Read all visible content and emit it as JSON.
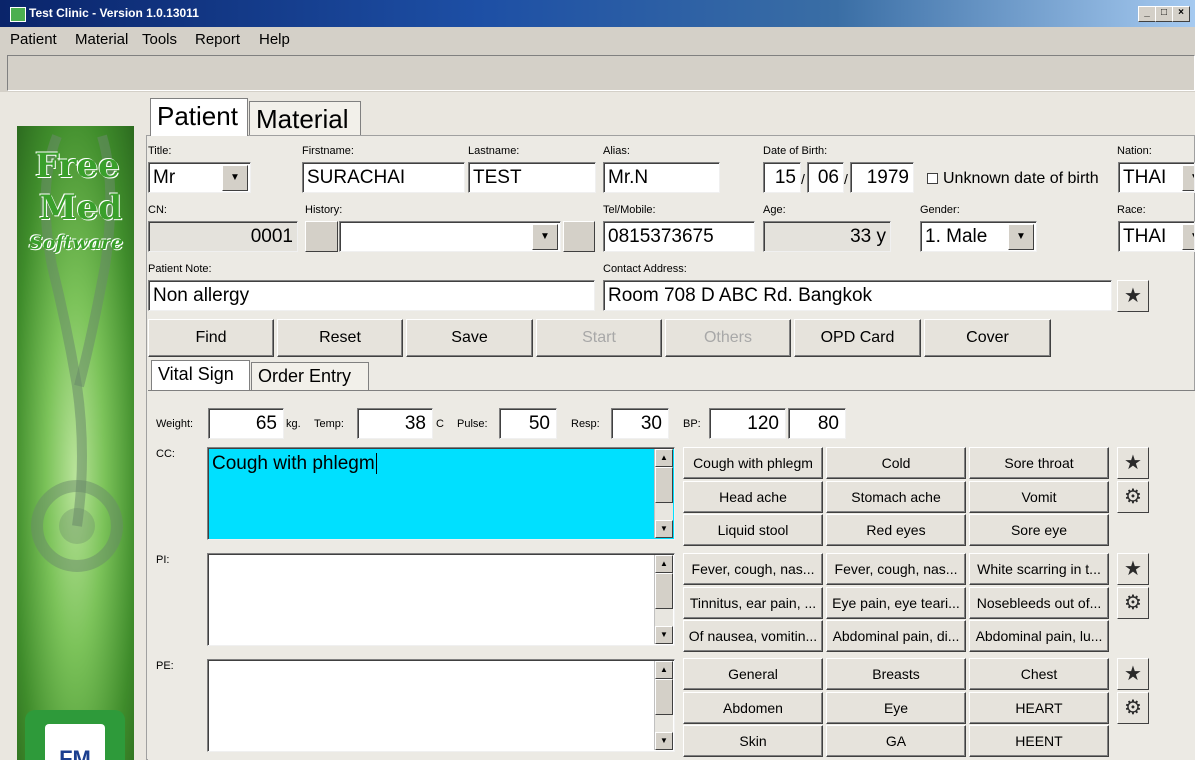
{
  "window": {
    "title": "Test Clinic - Version 1.0.13011",
    "min": "_",
    "max": "□",
    "close": "×"
  },
  "menu": [
    "Patient",
    "Material",
    "Tools",
    "Report",
    "Help"
  ],
  "sidebar": {
    "logo_line1": "Free",
    "logo_line2": "Med",
    "logo_line3": "Software",
    "badge": "FM"
  },
  "main_tabs": [
    "Patient",
    "Material"
  ],
  "form": {
    "title_label": "Title:",
    "title_value": "Mr",
    "firstname_label": "Firstname:",
    "firstname_value": "SURACHAI",
    "lastname_label": "Lastname:",
    "lastname_value": "TEST",
    "alias_label": "Alias:",
    "alias_value": "Mr.N",
    "dob_label": "Date of Birth:",
    "dob_day": "15",
    "dob_month": "06",
    "dob_year": "1979",
    "dob_sep": "/",
    "unknown_dob_label": "Unknown date of birth",
    "nation_label": "Nation:",
    "nation_value": "THAI",
    "cn_label": "CN:",
    "cn_value": "0001",
    "history_label": "History:",
    "history_value": "",
    "tel_label": "Tel/Mobile:",
    "tel_value": "0815373675",
    "age_label": "Age:",
    "age_value": "33 y",
    "gender_label": "Gender:",
    "gender_value": "1. Male",
    "race_label": "Race:",
    "race_value": "THAI",
    "note_label": "Patient Note:",
    "note_value": "Non allergy",
    "address_label": "Contact Address:",
    "address_value": "Room 708 D ABC Rd. Bangkok"
  },
  "actions": {
    "find": "Find",
    "reset": "Reset",
    "save": "Save",
    "start": "Start",
    "others": "Others",
    "opd_card": "OPD Card",
    "cover": "Cover"
  },
  "sub_tabs": [
    "Vital Sign",
    "Order Entry"
  ],
  "vitals": {
    "weight_label": "Weight:",
    "weight_value": "65",
    "weight_unit": "kg.",
    "temp_label": "Temp:",
    "temp_value": "38",
    "temp_unit": "C",
    "pulse_label": "Pulse:",
    "pulse_value": "50",
    "resp_label": "Resp:",
    "resp_value": "30",
    "bp_label": "BP:",
    "bp_sys": "120",
    "bp_dia": "80"
  },
  "cc": {
    "label": "CC:",
    "value": "Cough with phlegm",
    "quick": [
      "Cough with phlegm",
      "Cold",
      "Sore throat",
      "Head ache",
      "Stomach ache",
      "Vomit",
      "Liquid stool",
      "Red eyes",
      "Sore eye"
    ]
  },
  "pi": {
    "label": "PI:",
    "value": "",
    "quick": [
      "Fever, cough, nas...",
      "Fever, cough, nas...",
      "White scarring in t...",
      "Tinnitus, ear pain, ...",
      "Eye pain, eye teari...",
      "Nosebleeds out of...",
      "Of nausea, vomitin...",
      "Abdominal pain, di...",
      "Abdominal pain, lu..."
    ]
  },
  "pe": {
    "label": "PE:",
    "value": "",
    "quick": [
      "General",
      "Breasts",
      "Chest",
      "Abdomen",
      "Eye",
      "HEART",
      "Skin",
      "GA",
      "HEENT"
    ]
  },
  "icons": {
    "star": "★",
    "gear": "⚙",
    "down": "▼",
    "up": "▲"
  },
  "colors": {
    "cc_highlight": "#00e0ff",
    "title_bar": "#0a246a"
  }
}
